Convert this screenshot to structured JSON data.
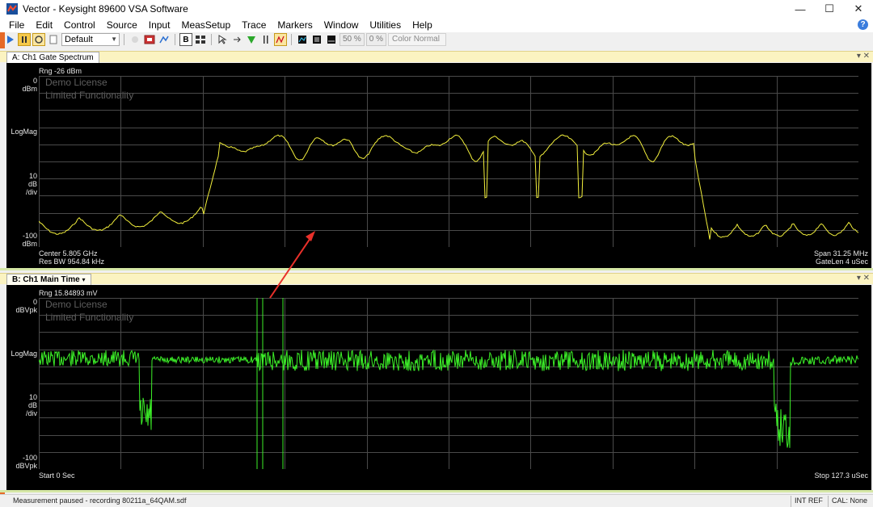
{
  "window": {
    "title": "Vector - Keysight 89600 VSA Software",
    "minimize": "—",
    "maximize": "☐",
    "close": "✕"
  },
  "menu": [
    "File",
    "Edit",
    "Control",
    "Source",
    "Input",
    "MeasSetup",
    "Trace",
    "Markers",
    "Window",
    "Utilities",
    "Help"
  ],
  "toolbar": {
    "preset": "Default",
    "zoom_a": "50 %",
    "zoom_b": "0 %",
    "color_mode": "Color Normal"
  },
  "panelA": {
    "tab": "A: Ch1 Gate Spectrum",
    "range": "Rng -26 dBm",
    "ref_value": "0",
    "ref_unit": "dBm",
    "scale_mode": "LogMag",
    "div_value": "10",
    "div_unit1": "dB",
    "div_unit2": "/div",
    "bottom_value": "-100",
    "bottom_unit": "dBm",
    "watermark1": "Demo License",
    "watermark2": "Limited Functionality",
    "center": "Center 5.805 GHz",
    "res_bw": "Res BW 954.84 kHz",
    "span": "Span 31.25 MHz",
    "gatelen": "GateLen 4 uSec",
    "trace_color": "#f2ef3c"
  },
  "panelB": {
    "tab": "B: Ch1 Main Time",
    "tab_arrow": "▾",
    "range": "Rng 15.84893 mV",
    "ref_value": "0",
    "ref_unit": "dBVpk",
    "scale_mode": "LogMag",
    "div_value": "10",
    "div_unit1": "dB",
    "div_unit2": "/div",
    "bottom_value": "-100",
    "bottom_unit": "dBVpk",
    "watermark1": "Demo License",
    "watermark2": "Limited Functionality",
    "start": "Start 0  Sec",
    "stop": "Stop 127.3 uSec",
    "trace_color": "#3cf028"
  },
  "panel_controls": "▾ ✕",
  "status": {
    "message": "Measurement paused - recording 80211a_64QAM.sdf",
    "ref": "INT REF",
    "cal": "CAL: None"
  },
  "annotation_color": "#e8302a"
}
